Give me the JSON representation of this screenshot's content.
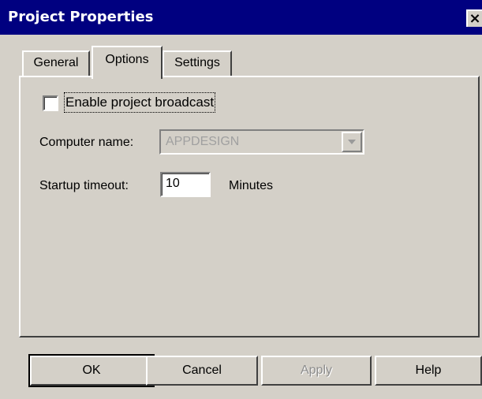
{
  "window": {
    "title": "Project Properties",
    "close_label": "×"
  },
  "tabs": [
    {
      "label": "General",
      "active": false
    },
    {
      "label": "Options",
      "active": true
    },
    {
      "label": "Settings",
      "active": false
    }
  ],
  "options": {
    "broadcast_checkbox": {
      "label": "Enable project broadcast",
      "checked": false
    },
    "computer_name": {
      "label": "Computer name:",
      "value": "APPDESIGN",
      "enabled": false
    },
    "startup_timeout": {
      "label": "Startup timeout:",
      "value": "10",
      "unit": "Minutes"
    }
  },
  "buttons": {
    "ok": "OK",
    "cancel": "Cancel",
    "apply": "Apply",
    "help": "Help"
  },
  "colors": {
    "titlebar": "#000080",
    "face": "#d4d0c8",
    "disabled_text": "#a0a0a0"
  }
}
